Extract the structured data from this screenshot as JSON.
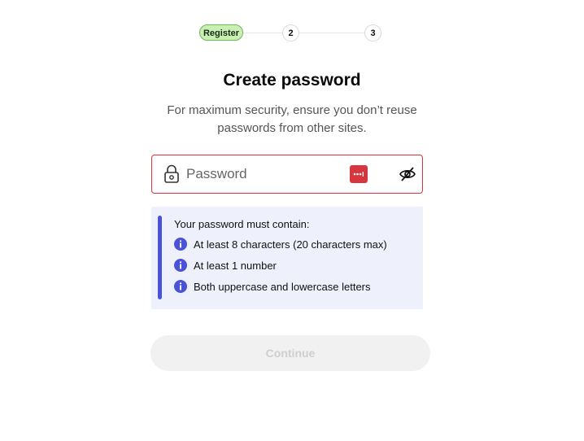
{
  "stepper": {
    "steps": [
      "Register",
      "2",
      "3"
    ],
    "active_color": "#c8f0b4"
  },
  "title": "Create password",
  "subtitle": "For maximum security, ensure you don’t reuse passwords from other sites.",
  "password_field": {
    "placeholder": "Password",
    "value": "",
    "lock_icon": "lock-icon",
    "password_manager_icon": "password-manager-icon",
    "visibility_icon": "eye-slash-icon",
    "error_color": "#d8363e"
  },
  "requirements": {
    "title": "Your password must contain:",
    "items": [
      "At least 8 characters (20 characters max)",
      "At least 1 number",
      "Both uppercase and lowercase letters"
    ],
    "accent_color": "#4a52d8",
    "background": "#eef1fc",
    "item_icon": "info-icon"
  },
  "continue_button": {
    "label": "Continue",
    "disabled": true
  }
}
